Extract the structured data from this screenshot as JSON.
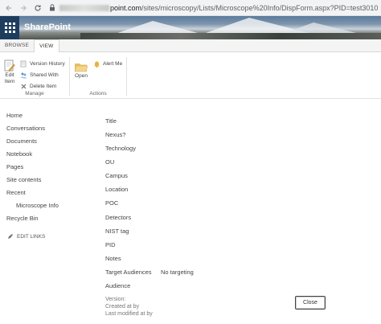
{
  "browser": {
    "back_icon": "arrow-left-icon",
    "forward_icon": "arrow-right-icon",
    "reload_icon": "reload-icon",
    "url_host_suffix": "point.com",
    "url_path": "/sites/microscopy/Lists/Microscope%20Info/DispForm.aspx?PID=test3010"
  },
  "suite": {
    "app_name": "SharePoint"
  },
  "ribbon_tabs": [
    "BROWSE",
    "VIEW"
  ],
  "ribbon": {
    "edit_item_label": "Edit Item",
    "version_history_label": "Version History",
    "shared_with_label": "Shared With",
    "delete_item_label": "Delete Item",
    "manage_group_label": "Manage",
    "open_label": "Open",
    "alert_me_label": "Alert Me",
    "actions_group_label": "Actions"
  },
  "leftnav": {
    "items": [
      "Home",
      "Conversations",
      "Documents",
      "Notebook",
      "Pages",
      "Site contents",
      "Recent"
    ],
    "sub_items": [
      "Microscope Info"
    ],
    "recycle_bin": "Recycle Bin",
    "edit_links": "EDIT LINKS"
  },
  "form": {
    "fields": [
      {
        "label": "Title",
        "value": ""
      },
      {
        "label": "Nexus?",
        "value": ""
      },
      {
        "label": "Technology",
        "value": ""
      },
      {
        "label": "OU",
        "value": ""
      },
      {
        "label": "Campus",
        "value": ""
      },
      {
        "label": "Location",
        "value": ""
      },
      {
        "label": "POC",
        "value": ""
      },
      {
        "label": "Detectors",
        "value": ""
      },
      {
        "label": "NIST tag",
        "value": ""
      },
      {
        "label": "PID",
        "value": ""
      },
      {
        "label": "Notes",
        "value": ""
      },
      {
        "label": "Target Audiences",
        "value": "No targeting"
      },
      {
        "label": "Audience",
        "value": ""
      }
    ],
    "version_label": "Version:",
    "created_label": "Created at by",
    "modified_label": "Last modified at by",
    "close_label": "Close"
  }
}
